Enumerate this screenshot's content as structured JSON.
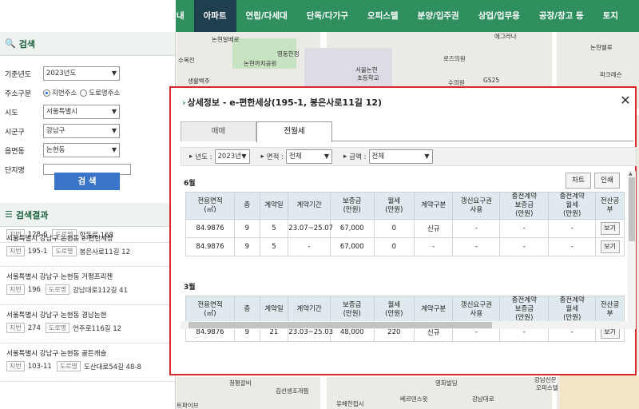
{
  "nav": {
    "items": [
      {
        "label": "공개안내",
        "active": false
      },
      {
        "label": "아파트",
        "active": true
      },
      {
        "label": "연립/다세대",
        "active": false
      },
      {
        "label": "단독/다가구",
        "active": false
      },
      {
        "label": "오피스텔",
        "active": false
      },
      {
        "label": "분양/입주권",
        "active": false
      },
      {
        "label": "상업/업무용",
        "active": false
      },
      {
        "label": "공장/창고 등",
        "active": false
      },
      {
        "label": "토지",
        "active": false
      }
    ]
  },
  "search": {
    "title": "검색",
    "year_label": "기준년도",
    "year_value": "2023년도",
    "addr_type_label": "주소구분",
    "addr_opt1": "지번주소",
    "addr_opt2": "도로명주소",
    "sido_label": "시도",
    "sido_value": "서울특별시",
    "sigungu_label": "시군구",
    "sigungu_value": "강남구",
    "dong_label": "읍면동",
    "dong_value": "논현동",
    "complex_label": "단지명",
    "complex_value": "",
    "button": "검 색"
  },
  "results": {
    "title": "검색결과",
    "partial": {
      "jibun_tag": "지번",
      "jibun": "128-6",
      "road_tag": "도로명",
      "road": "학동로 168"
    },
    "items": [
      {
        "addr": "서울특별시 강남구 논현동 e-편한세상",
        "jibun_tag": "지번",
        "jibun": "195-1",
        "road_tag": "도로명",
        "road": "봉은사로11길 12"
      },
      {
        "addr": "서울특별시 강남구 논현동 거평프리젠",
        "jibun_tag": "지번",
        "jibun": "196",
        "road_tag": "도로명",
        "road": "강남대로112길 41"
      },
      {
        "addr": "서울특별시 강남구 논현동 경남논현",
        "jibun_tag": "지번",
        "jibun": "274",
        "road_tag": "도로명",
        "road": "언주로116길 12"
      },
      {
        "addr": "서울특별시 강남구 논현동 골든캐슬",
        "jibun_tag": "지번",
        "jibun": "103-11",
        "road_tag": "도로명",
        "road": "도산대로54길 48-8"
      }
    ]
  },
  "map": {
    "labels": [
      "논현알베로",
      "영동한정",
      "논현까치공원",
      "서울논현",
      "초등학교",
      "로즈의원",
      "에그라나",
      "논현웰루",
      "수목전",
      "생활백주",
      "파크레슨",
      "GS25",
      "수의원",
      "청평갈비",
      "김선생조개찜",
      "영화빌딩",
      "유해한접시",
      "베르덴스윗",
      "강남대로",
      "강남신문",
      "오피스텔",
      "트파이브"
    ]
  },
  "dialog": {
    "title": "상세정보 - e-편한세상(195-1, 봉은사로11길 12)",
    "close": "✕",
    "tabs": [
      "매매",
      "전월세"
    ],
    "active_tab": 1,
    "filter": {
      "year_label": "년도 :",
      "year_value": "2023년",
      "area_label": "면적 :",
      "area_value": "전체",
      "amount_label": "금액 :",
      "amount_value": "전체"
    },
    "chart_btn": "차트",
    "print_btn": "인쇄",
    "headers": [
      "전용면적\n(㎡)",
      "층",
      "계약일",
      "계약기간",
      "보증금\n(만원)",
      "월세\n(만원)",
      "계약구분",
      "갱신요구권\n사용",
      "종전계약\n보증금\n(만원)",
      "종전계약\n월세\n(만원)",
      "전산공\n부"
    ],
    "sections": [
      {
        "month": "6월",
        "rows": [
          [
            "84.9876",
            "9",
            "5",
            "23.07~25.07",
            "67,000",
            "0",
            "신규",
            "-",
            "-",
            "-",
            "보기"
          ],
          [
            "84.9876",
            "9",
            "5",
            "-",
            "67,000",
            "0",
            "-",
            "-",
            "-",
            "-",
            "보기"
          ]
        ]
      },
      {
        "month": "3월",
        "rows": [
          [
            "84.9876",
            "9",
            "21",
            "23.03~25.03",
            "48,000",
            "220",
            "신규",
            "-",
            "-",
            "-",
            "보기"
          ]
        ]
      }
    ]
  }
}
